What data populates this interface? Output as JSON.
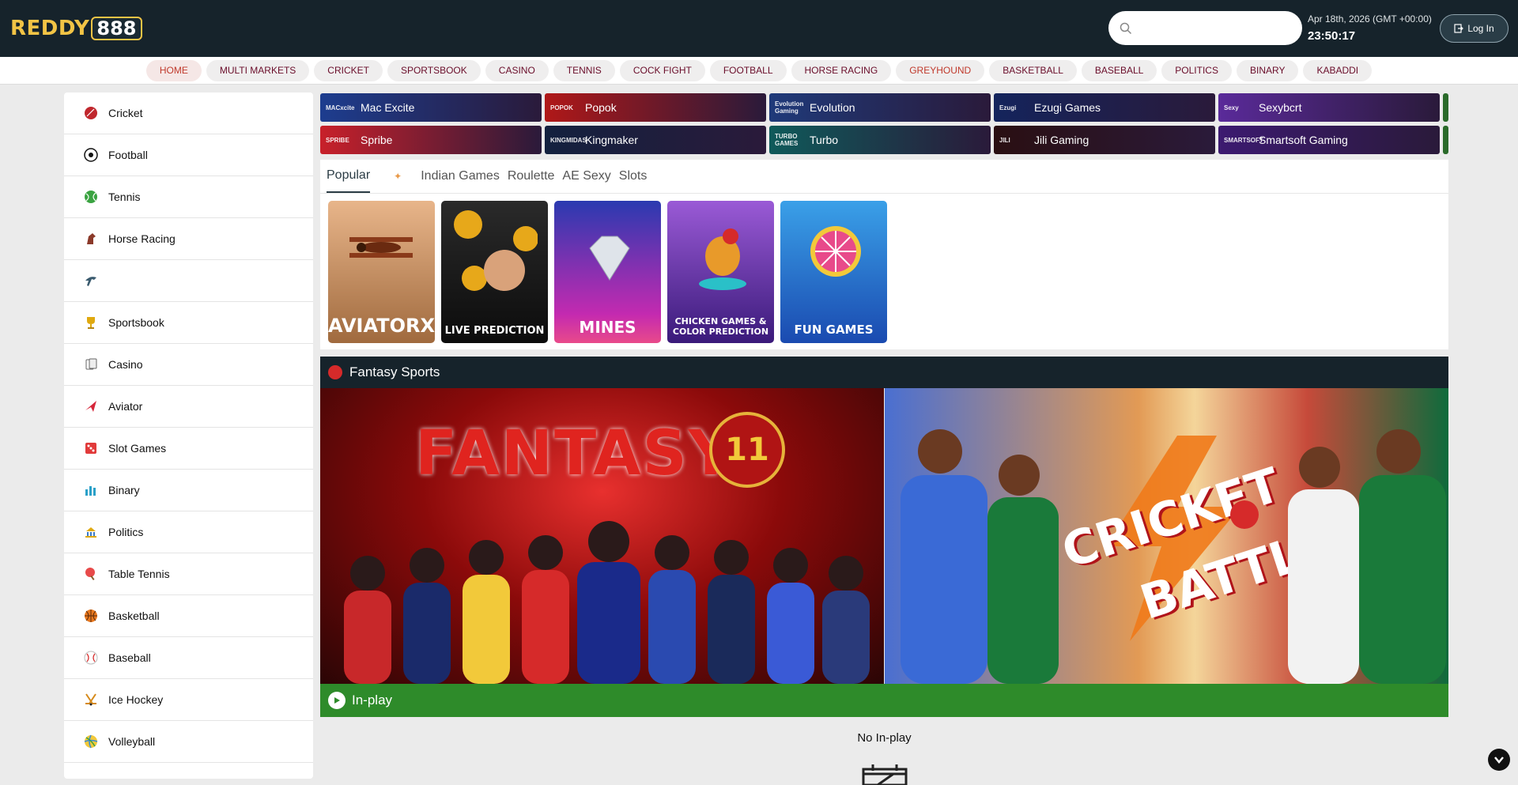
{
  "header": {
    "logo_text": "REDDY",
    "logo_number": "888",
    "search_placeholder": "",
    "date": "Apr 18th, 2026 (GMT +00:00)",
    "time": "23:50:17",
    "login_label": "Log In"
  },
  "nav": [
    "HOME",
    "MULTI MARKETS",
    "CRICKET",
    "SPORTSBOOK",
    "CASINO",
    "TENNIS",
    "COCK FIGHT",
    "FOOTBALL",
    "HORSE RACING",
    "GREYHOUND",
    "BASKETBALL",
    "BASEBALL",
    "POLITICS",
    "BINARY",
    "KABADDI"
  ],
  "sidebar": [
    {
      "label": "Cricket",
      "icon": "cricket-icon"
    },
    {
      "label": "Football",
      "icon": "football-icon"
    },
    {
      "label": "Tennis",
      "icon": "tennis-icon"
    },
    {
      "label": "Horse Racing",
      "icon": "horse-icon"
    },
    {
      "label": "",
      "icon": "greyhound-icon"
    },
    {
      "label": "Sportsbook",
      "icon": "trophy-icon"
    },
    {
      "label": "Casino",
      "icon": "cards-icon"
    },
    {
      "label": "Aviator",
      "icon": "plane-icon"
    },
    {
      "label": "Slot Games",
      "icon": "slot-icon"
    },
    {
      "label": "Binary",
      "icon": "chart-icon"
    },
    {
      "label": "Politics",
      "icon": "politics-icon"
    },
    {
      "label": "Table Tennis",
      "icon": "table-tennis-icon"
    },
    {
      "label": "Basketball",
      "icon": "basketball-icon"
    },
    {
      "label": "Baseball",
      "icon": "baseball-icon"
    },
    {
      "label": "Ice Hockey",
      "icon": "ice-hockey-icon"
    },
    {
      "label": "Volleyball",
      "icon": "volleyball-icon"
    }
  ],
  "providers": [
    {
      "logo": "MACxcite",
      "name": "Mac Excite",
      "color": "#1d3d8f"
    },
    {
      "logo": "POPOK",
      "name": "Popok",
      "color": "#b01818"
    },
    {
      "logo": "Evolution Gaming",
      "name": "Evolution",
      "color": "#1f3a7a"
    },
    {
      "logo": "Ezugi",
      "name": "Ezugi Games",
      "color": "#14245c"
    },
    {
      "logo": "Sexy",
      "name": "Sexybcrt",
      "color": "#5a2a9a"
    },
    {
      "logo": "SPRIBE",
      "name": "Spribe",
      "color": "#c8202a"
    },
    {
      "logo": "KINGMIDAS",
      "name": "Kingmaker",
      "color": "#13213f"
    },
    {
      "logo": "TURBO GAMES",
      "name": "Turbo",
      "color": "#0f5a5a"
    },
    {
      "logo": "JILI",
      "name": "Jili Gaming",
      "color": "#2a0f12"
    },
    {
      "logo": "SMARTSOFT",
      "name": "Smartsoft Gaming",
      "color": "#3c1a70"
    }
  ],
  "tabs": [
    "Popular",
    "Indian Games",
    "Roulette",
    "AE Sexy",
    "Slots"
  ],
  "games": [
    {
      "label": "AVIATORX",
      "bg": "#c9895a"
    },
    {
      "label": "LIVE PREDICTION",
      "bg": "#1a1a1a"
    },
    {
      "label": "MINES",
      "bg": "#7a2bd1"
    },
    {
      "label": "CHICKEN GAMES & COLOR PREDICTION",
      "bg": "#6b2bb0"
    },
    {
      "label": "FUN GAMES",
      "bg": "#2a6ed6"
    }
  ],
  "fantasy_title": "Fantasy Sports",
  "banner_left_title": "FANTASY",
  "banner_left_badge": "11",
  "banner_right_title_1": "CRICKET",
  "banner_right_title_2": "BATTLE",
  "inplay_title": "In-play",
  "no_inplay_text": "No In-play"
}
